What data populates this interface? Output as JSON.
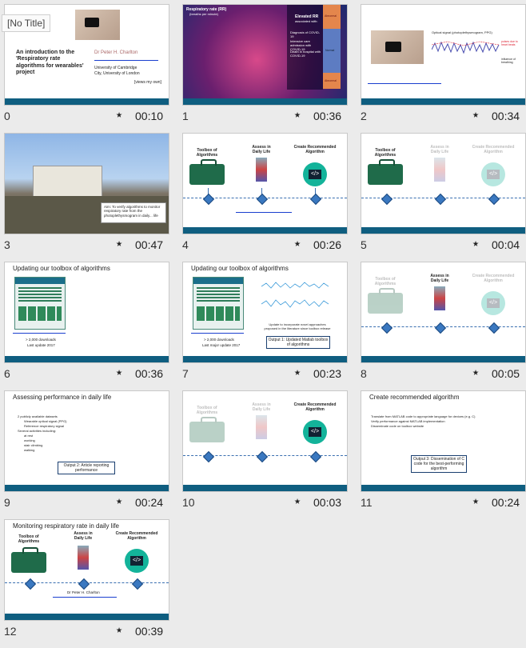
{
  "window": {
    "tooltip": "[No Title]"
  },
  "slides": [
    {
      "index": "0",
      "duration": "00:10",
      "title": "An introduction to the 'Respiratory rate algorithms for wearables' project",
      "author": "Dr Peter H. Charlton",
      "affil1": "University of Cambridge",
      "affil2": "City, University of London",
      "note": "[views my own]"
    },
    {
      "index": "1",
      "duration": "00:36",
      "title": "Respiratory rate (RR)",
      "subtitle": "(breaths per minute)",
      "panel_title": "Elevated RR",
      "panel_sub": "associated with:",
      "items": [
        "Diagnosis of COVID-19",
        "Intensive care admission with COVID-19",
        "Death in hospital with COVID-19"
      ],
      "scale_top": "Abnormal",
      "scale_mid": "Normal",
      "scale_low": "Abnormal"
    },
    {
      "index": "2",
      "duration": "00:34",
      "label": "Optical signal (photoplethysmogram, PPG)",
      "note1": "pulses due to heart beats",
      "note2": "influence of breathing"
    },
    {
      "index": "3",
      "duration": "00:47",
      "caption": "Aim: To verify algorithms to monitor respiratory rate from the photoplethysmogram in daily... life"
    },
    {
      "index": "4",
      "duration": "00:26",
      "col1": "Toolbox of Algorithms",
      "col2": "Assess in Daily Life",
      "col3": "Create Recommended Algorithm"
    },
    {
      "index": "5",
      "duration": "00:04",
      "col1": "Toolbox of Algorithms",
      "col2": "Assess in Daily Life",
      "col3": "Create Recommended Algorithm"
    },
    {
      "index": "6",
      "duration": "00:36",
      "title": "Updating our toolbox of algorithms",
      "dl1": "> 2,000 downloads",
      "dl2": "Last update 2017"
    },
    {
      "index": "7",
      "duration": "00:23",
      "title": "Updating our toolbox of algorithms",
      "dl1": "> 2,000 downloads",
      "dl2": "Last major update 2017",
      "update": "Update to incorporate novel approaches proposed in the literature since toolbox release",
      "output": "Output 1: Updated Matlab toolbox of algorithms"
    },
    {
      "index": "8",
      "duration": "00:05",
      "col1": "Toolbox of Algorithms",
      "col2": "Assess in Daily Life",
      "col3": "Create Recommended Algorithm"
    },
    {
      "index": "9",
      "duration": "00:24",
      "title": "Assessing performance in daily life",
      "bullets": [
        "2 publicly available datasets",
        "Wearable optical signal (PPG)",
        "Reference respiratory signal",
        "Several activities including:",
        "at rest",
        "working",
        "stair climbing",
        "walking"
      ],
      "output": "Output 2: Article reporting performance"
    },
    {
      "index": "10",
      "duration": "00:03",
      "col1": "Toolbox of Algorithms",
      "col2": "Assess in Daily Life",
      "col3": "Create Recommended Algorithm"
    },
    {
      "index": "11",
      "duration": "00:24",
      "title": "Create recommended algorithm",
      "bullets": [
        "Translate from MATLAB code to appropriate language for devices (e.g. C)",
        "Verify performance against MATLAB implementation",
        "Disseminate code on toolbox website"
      ],
      "output": "Output 3: Dissemination of C code for the best-performing algorithm"
    },
    {
      "index": "12",
      "duration": "00:39",
      "title": "Monitoring respiratory rate in daily life",
      "col1": "Toolbox of Algorithms",
      "col2": "Assess in Daily Life",
      "col3": "Create Recommended Algorithm",
      "author": "Dr Peter H. Charlton"
    }
  ]
}
